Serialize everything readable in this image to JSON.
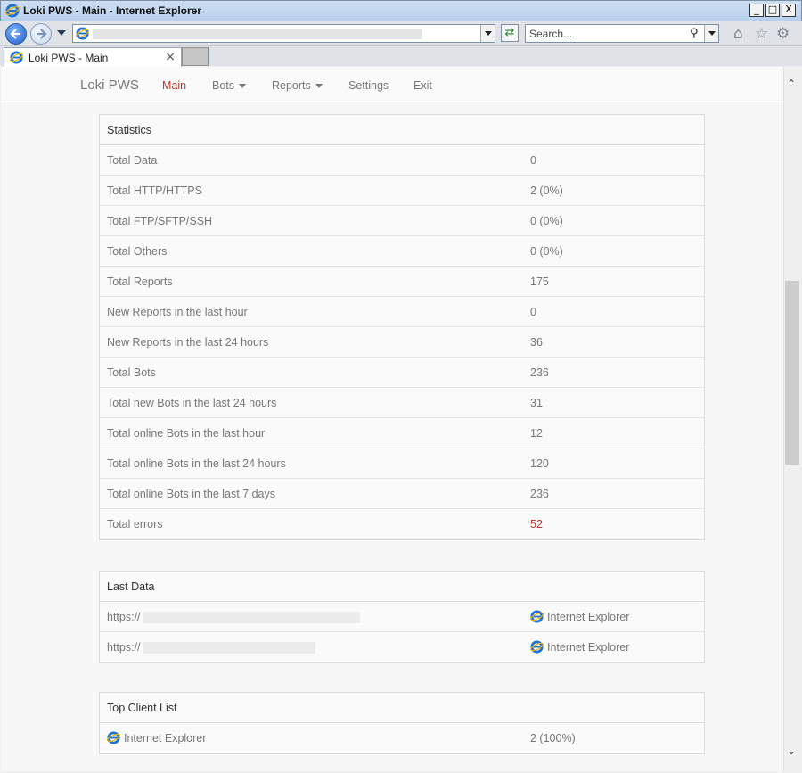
{
  "window": {
    "title": "Loki PWS - Main - Internet Explorer",
    "min": "_",
    "max": "□",
    "close": "X"
  },
  "toolbar": {
    "search_placeholder": "Search...",
    "refresh_glyph": "⇄",
    "search_glyph": "⚲",
    "home_glyph": "⌂",
    "fav_glyph": "☆",
    "tools_glyph": "⚙"
  },
  "tab": {
    "label": "Loki PWS - Main",
    "close": "×"
  },
  "nav": {
    "brand": "Loki PWS",
    "main": "Main",
    "bots": "Bots",
    "reports": "Reports",
    "settings": "Settings",
    "exit": "Exit"
  },
  "statistics": {
    "heading": "Statistics",
    "rows": [
      {
        "label": "Total Data",
        "value": "0"
      },
      {
        "label": "Total HTTP/HTTPS",
        "value": "2 (0%)"
      },
      {
        "label": "Total FTP/SFTP/SSH",
        "value": "0 (0%)"
      },
      {
        "label": "Total Others",
        "value": "0 (0%)"
      },
      {
        "label": "Total Reports",
        "value": "175"
      },
      {
        "label": "New Reports in the last hour",
        "value": "0"
      },
      {
        "label": "New Reports in the last 24 hours",
        "value": "36"
      },
      {
        "label": "Total Bots",
        "value": "236"
      },
      {
        "label": "Total new Bots in the last 24 hours",
        "value": "31"
      },
      {
        "label": "Total online Bots in the last hour",
        "value": "12"
      },
      {
        "label": "Total online Bots in the last 24 hours",
        "value": "120"
      },
      {
        "label": "Total online Bots in the last 7 days",
        "value": "236"
      },
      {
        "label": "Total errors",
        "value": "52"
      }
    ]
  },
  "last_data": {
    "heading": "Last Data",
    "rows": [
      {
        "url": "https://",
        "browser": "Internet Explorer"
      },
      {
        "url": "https://",
        "browser": "Internet Explorer"
      }
    ]
  },
  "top_clients": {
    "heading": "Top Client List",
    "rows": [
      {
        "client": "Internet Explorer",
        "value": "2 (100%)"
      }
    ]
  },
  "colors": {
    "accent": "#c0392b",
    "text_muted": "#777777"
  }
}
